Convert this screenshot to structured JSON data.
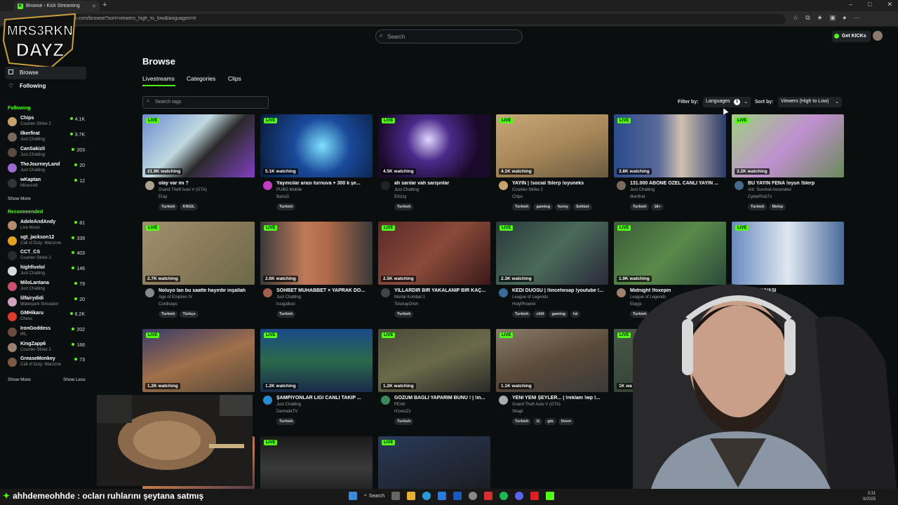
{
  "browser": {
    "tab_title": "Browse - Kick Streaming",
    "new_tab": "+",
    "url": "kick.com/browse?sort=viewers_high_to_low&languages=tr",
    "window_controls": [
      "–",
      "□",
      "✕"
    ]
  },
  "overlay": {
    "logo_line1": "MRS3RKN",
    "logo_line2": "DAYZ"
  },
  "header": {
    "search_placeholder": "Search",
    "get_kicks": "Get KICKs"
  },
  "sidebar": {
    "browse": "Browse",
    "following_nav": "Following",
    "following_heading": "Following",
    "following": [
      {
        "name": "Chips",
        "category": "Counter-Strike 2",
        "viewers": "4.1K",
        "color": "#c8a26a"
      },
      {
        "name": "Ilkerfirat",
        "category": "Just Chatting",
        "viewers": "3.7K",
        "color": "#7a6a5e"
      },
      {
        "name": "CanSakizli",
        "category": "Just Chatting",
        "viewers": "203",
        "color": "#5d4b3f"
      },
      {
        "name": "TheJourneyLand",
        "category": "Just Chatting",
        "viewers": "20",
        "color": "#9c6bd0"
      },
      {
        "name": "wKaptan",
        "category": "Minecraft",
        "viewers": "12",
        "color": "#333"
      }
    ],
    "show_more_1": "Show More",
    "recommended_heading": "Recommended",
    "recommended": [
      {
        "name": "AdeleAndAndy",
        "category": "Live Music",
        "viewers": "81",
        "color": "#b58b6b"
      },
      {
        "name": "sgt_jackson12",
        "category": "Call of Duty: Warzone",
        "viewers": "339",
        "color": "#e0a020"
      },
      {
        "name": "CCT_CS",
        "category": "Counter-Strike 2",
        "viewers": "403",
        "color": "#2b2b2b"
      },
      {
        "name": "highfivelol",
        "category": "Just Chatting",
        "viewers": "146",
        "color": "#d9d9d9"
      },
      {
        "name": "MiloLantana",
        "category": "Just Chatting",
        "viewers": "79",
        "color": "#c85070"
      },
      {
        "name": "lilfairydidi",
        "category": "Waterpark Simulator",
        "viewers": "20",
        "color": "#d0a0c0"
      },
      {
        "name": "GMHikaru",
        "category": "Chess",
        "viewers": "6.2K",
        "color": "#e03a2a"
      },
      {
        "name": "IronGoddess",
        "category": "IRL",
        "viewers": "202",
        "color": "#6b4b3b"
      },
      {
        "name": "KingZapp6",
        "category": "Counter-Strike 2",
        "viewers": "166",
        "color": "#9a8070"
      },
      {
        "name": "GreaseMonkey",
        "category": "Call of Duty: Warzone",
        "viewers": "73",
        "color": "#7a5a40"
      }
    ],
    "show_more_2": "Show More",
    "show_less": "Show Less"
  },
  "main": {
    "title": "Browse",
    "tabs": [
      "Livestreams",
      "Categories",
      "Clips"
    ],
    "tags_placeholder": "Search tags",
    "filter_label": "Filter by:",
    "languages_label": "Languages",
    "languages_count": "1",
    "sort_label": "Sort by:",
    "sort_value": "Viewers (High to Low)",
    "live_badge": "LIVE",
    "cards": [
      {
        "watching": "21.9K watching",
        "title": "olay var mı ?",
        "category": "Grand Theft Auto V (GTA)",
        "user": "Eray",
        "tags": [
          "Turkish",
          "KNGIL"
        ],
        "thumb": "linear-gradient(135deg,#6b8bd0,#c0d8e0 40%,#2a2a2a 60%,#8040c0)",
        "avatar": "#b0a090"
      },
      {
        "watching": "5.1K watching",
        "title": "Yayıncılar arası turnuva + 300 k şe...",
        "category": "PUBG Mobile",
        "user": "BarisG",
        "tags": [
          "Turkish"
        ],
        "thumb": "radial-gradient(circle at 55% 50%,#7de0ff,#1a4a9a 40%,#0a1a3a)",
        "avatar": "#c040c0"
      },
      {
        "watching": "4.5K watching",
        "title": "ah sarılar vah sarışınlar",
        "category": "Just Chatting",
        "user": "Erlizzy",
        "tags": [
          "Turkish"
        ],
        "thumb": "radial-gradient(circle at 45% 40%,#e0d8ff,#4a2a8a 30%,#1a0a2a 70%)",
        "avatar": "#222"
      },
      {
        "watching": "4.1K watching",
        "title": "YAYIN | !social !blerp !oyuneks",
        "category": "Counter-Strike 2",
        "user": "Chips",
        "tags": [
          "Turkish",
          "gaming",
          "funny",
          "Sohbet"
        ],
        "thumb": "linear-gradient(160deg,#c8a878,#a8885a 50%,#6a5a40)",
        "avatar": "#c8a26a"
      },
      {
        "watching": "3.8K watching",
        "title": "131.000 ABONE ÖZEL CANLI YAYIN ...",
        "category": "Just Chatting",
        "user": "Ilkerfirat",
        "tags": [
          "Turkish",
          "18+"
        ],
        "thumb": "linear-gradient(90deg,#2a4a8a,#5a6a9a 40%,#d0c0b0 60%,#2a3a6a)",
        "avatar": "#7a6a5e"
      },
      {
        "watching": "3.2K watching",
        "title": "BU YAYIN FENA !oyun !blerp",
        "category": "Ark: Survival Ascended",
        "user": "CyberRulzTv",
        "tags": [
          "Turkish",
          "Mekip"
        ],
        "thumb": "linear-gradient(135deg,#a0d080,#c090d0 50%,#6a8a5a)",
        "avatar": "#4a6a8a"
      },
      {
        "watching": "2.7K watching",
        "title": "Noluyo lan bu saatte hayırdır inşallah",
        "category": "Age of Empires IV",
        "user": "Cordiseps",
        "tags": [
          "Turkish",
          "Türkçe"
        ],
        "thumb": "linear-gradient(135deg,#a09070,#8a7a5a 50%,#6a6a4a)",
        "avatar": "#888"
      },
      {
        "watching": "2.6K watching",
        "title": "SOHBET MUHABBET × YAPRAK DÖ...",
        "category": "Just Chatting",
        "user": "tssigalkoo",
        "tags": [
          "Turkish"
        ],
        "thumb": "linear-gradient(90deg,#3a3a3a,#c07a5a 40%,#b06a4a 60%,#3a3a3a)",
        "avatar": "#a06050"
      },
      {
        "watching": "2.5K watching",
        "title": "YILLARDIR BİR YAKALANIP BİR KAÇ...",
        "category": "Mortal Kombat 1",
        "user": "TolunayOren",
        "tags": [
          "Turkish"
        ],
        "thumb": "linear-gradient(135deg,#5a2a2a,#8a4a3a 50%,#3a1a1a)",
        "avatar": "#444"
      },
      {
        "watching": "2.3K watching",
        "title": "KEDİ DUOSU | !lincehesap !youtube !...",
        "category": "League of Legends",
        "user": "HolyPhoenix",
        "tags": [
          "Turkish",
          "chill",
          "gaming",
          "lol"
        ],
        "thumb": "linear-gradient(135deg,#2a3a3a,#4a6a5a 50%,#2a2a3a)",
        "avatar": "#3a6a9a"
      },
      {
        "watching": "1.9K watching",
        "title": "Midnight !foxepin",
        "category": "League of Legends",
        "user": "Elayja",
        "tags": [
          "Turkish"
        ],
        "thumb": "linear-gradient(135deg,#3a5a3a,#5a8a4a 50%,#2a4a3a)",
        "avatar": "#a08070"
      },
      {
        "watching": "",
        "title": "TURNUVASI",
        "category": "",
        "user": "",
        "tags": [],
        "thumb": "linear-gradient(90deg,#6a8ac0,#e0e8f0 50%,#4a6a9a)",
        "avatar": "#556"
      },
      {
        "watching": "1.2K watching",
        "title": "",
        "category": "",
        "user": "",
        "tags": [],
        "thumb": "linear-gradient(160deg,#3a3a6a,#a0704a 50%,#5a4a3a)",
        "avatar": "#666"
      },
      {
        "watching": "1.2K watching",
        "title": "ŞAMPİYONLAR LİGİ CANLI TAKİP ...",
        "category": "Just Chatting",
        "user": "DemodeTV",
        "tags": [
          "Turkish"
        ],
        "thumb": "linear-gradient(180deg,#1a4a8a,#2a6a4a 50%,#1a2a4a)",
        "avatar": "#2a8ad0"
      },
      {
        "watching": "1.2K watching",
        "title": "GÖZÜM BAĞLI YAPARIM BUNU ! | !in...",
        "category": "PEAK",
        "user": "H1vezZz",
        "tags": [
          "Turkish"
        ],
        "thumb": "linear-gradient(160deg,#4a4a3a,#6a6a4a 50%,#2a2a2a)",
        "avatar": "#3a8a5a"
      },
      {
        "watching": "1.1K watching",
        "title": "YENİ YENİ ŞEYLER... | !reklam !wp !...",
        "category": "Grand Theft Auto V (GTA)",
        "user": "Shapi",
        "tags": [
          "Turkish",
          "t1",
          "gta",
          "fivem"
        ],
        "thumb": "linear-gradient(160deg,#8a7a6a,#5a4a3a 50%,#3a3a3a)",
        "avatar": "#aaa"
      },
      {
        "watching": "1K wa",
        "title": "",
        "category": "",
        "user": "",
        "tags": [],
        "thumb": "linear-gradient(160deg,#4a5a4a,#2a3a2a)",
        "avatar": "#776"
      },
      {
        "watching": "",
        "title": "",
        "category": "",
        "user": "",
        "tags": [],
        "thumb": "linear-gradient(160deg,#3a3a3a,#5a4a3a 50%,#2a2a2a)",
        "avatar": "#555"
      },
      {
        "watching": "",
        "title": "",
        "category": "",
        "user": "",
        "tags": [],
        "thumb": "linear-gradient(160deg,#6a3a8a,#c07a4a 50%,#3a2a4a)",
        "avatar": "#555"
      },
      {
        "watching": "",
        "title": "",
        "category": "",
        "user": "",
        "tags": [],
        "thumb": "linear-gradient(180deg,#1a1a1a,#3a3a3a 50%,#1a1a1a)",
        "avatar": "#555"
      },
      {
        "watching": "",
        "title": "",
        "category": "",
        "user": "",
        "tags": [],
        "thumb": "linear-gradient(160deg,#2a3a5a,#1a1a1a)",
        "avatar": "#555"
      }
    ]
  },
  "ticker": {
    "text": "ahhdemeohhde : ocları ruhlarını şeytana satmış"
  },
  "taskbar": {
    "search": "Search",
    "time": "3:31",
    "date": "9/2025"
  },
  "colors": {
    "accent": "#53fc18",
    "background": "#0b0e0f"
  }
}
